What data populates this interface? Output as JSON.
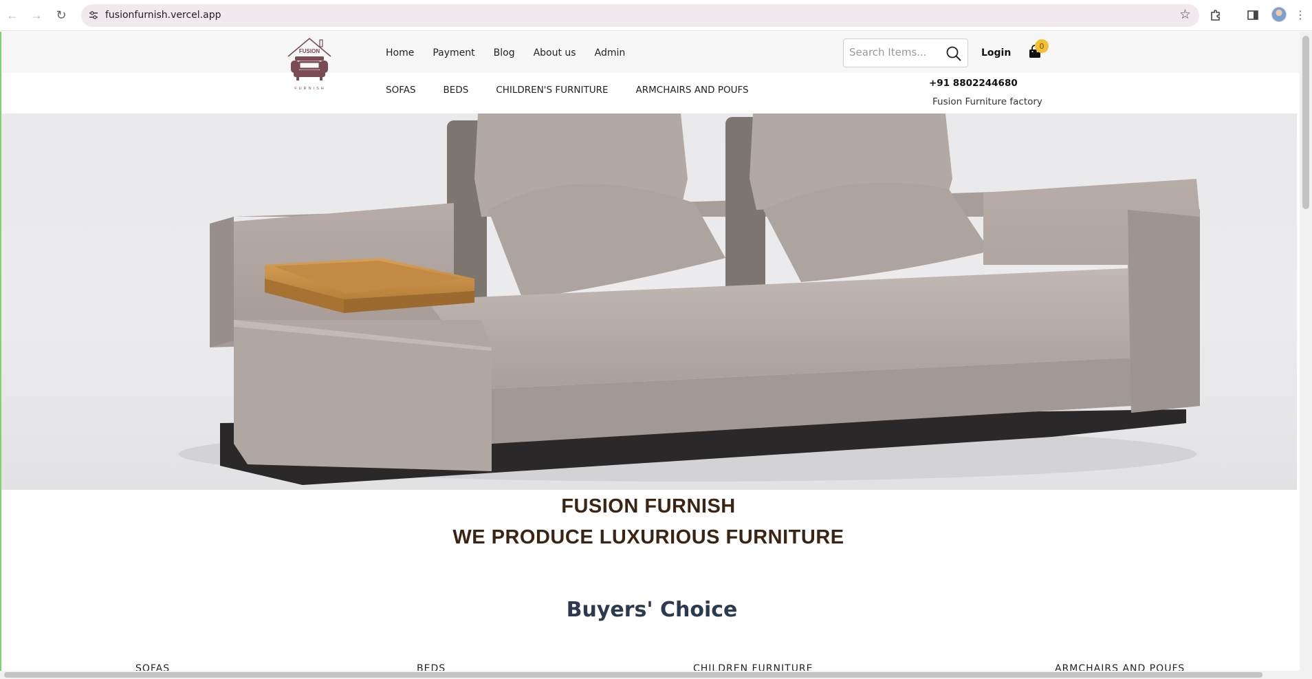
{
  "browser": {
    "url": "fusionfurnish.vercel.app",
    "icons": [
      "back-icon",
      "forward-icon",
      "reload-icon",
      "site-info-icon",
      "star-icon",
      "extensions-icon",
      "sidebar-icon",
      "profile-avatar",
      "menu-icon"
    ]
  },
  "header": {
    "logo_text": "FUSION",
    "logo_sub": "FURNISH",
    "nav": [
      "Home",
      "Payment",
      "Blog",
      "About us",
      "Admin"
    ],
    "search_placeholder": "Search Items...",
    "login_label": "Login",
    "cart_count": "0",
    "categories": [
      "SOFAS",
      "BEDS",
      "CHILDREN'S FURNITURE",
      "ARMCHAIRS AND POUFS"
    ],
    "phone": "+91 8802244680",
    "factory": "Fusion Furniture factory"
  },
  "hero": {
    "title": "FUSION FURNISH",
    "subtitle": "WE PRODUCE LUXURIOUS FURNITURE"
  },
  "buyers_choice": {
    "title": "Buyers' Choice",
    "categories": [
      "SOFAS",
      "BEDS",
      "CHILDREN FURNITURE",
      "ARMCHAIRS AND POUFS"
    ]
  },
  "colors": {
    "accent": "#f3c033",
    "heading": "#3a2413",
    "section_heading": "#2b3a4e",
    "logo": "#7a4a55"
  }
}
